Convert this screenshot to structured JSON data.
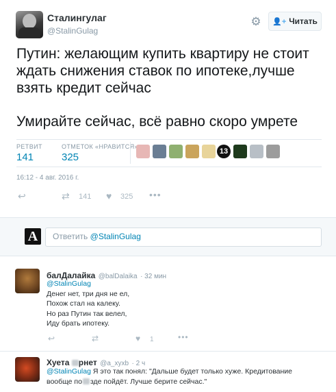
{
  "author": {
    "name": "Сталингулаг",
    "handle": "@StalinGulag"
  },
  "follow_button": {
    "label": "Читать"
  },
  "tweet": {
    "paragraphs": [
      "Путин: желающим купить квартиру не стоит ждать снижения ставок по ипотеке,лучше взять кредит сейчас",
      "Умирайте сейчас, всё равно скоро умрете"
    ]
  },
  "stats": {
    "retweets_label": "РЕТВИТ",
    "retweets": "141",
    "likes_label": "ОТМЕТОК «НРАВИТСЯ»",
    "likes": "325"
  },
  "likers": [
    "#e7b7b5",
    "#6a7e94",
    "#8fb070",
    "#caa45c",
    "#e8d49a",
    "#111111",
    "#1e3a1c",
    "#b8bfc6",
    "#9c9c9c"
  ],
  "likers_badge": "13",
  "timestamp": "16:12 - 4 авг. 2016 г.",
  "actions": {
    "retweet_count": "141",
    "like_count": "325"
  },
  "reply_box": {
    "placeholder_prefix": "Ответить ",
    "placeholder_mention": "@StalinGulag"
  },
  "replies": [
    {
      "name": "балДалайка",
      "handle": "@balDalaika",
      "time": "· 32 мин",
      "mention": "@StalinGulag",
      "lines": [
        "Денег нет, три дня не ел,",
        "Похож стал на калеку.",
        "Но раз Путин так велел,",
        "Иду брать ипотеку."
      ],
      "like_count": "1"
    },
    {
      "name_prefix": "Хуета ",
      "name_suffix": "рнет",
      "handle": "@a_xyxb",
      "time": "· 2 ч",
      "mention": "@StalinGulag",
      "text_line1": " Я это так понял: \"Дальше будет только хуже. Кредитование",
      "text_line2_a": "вообще по",
      "text_line2_b": "зде пойдёт. Лучше берите сейчас.\""
    }
  ]
}
